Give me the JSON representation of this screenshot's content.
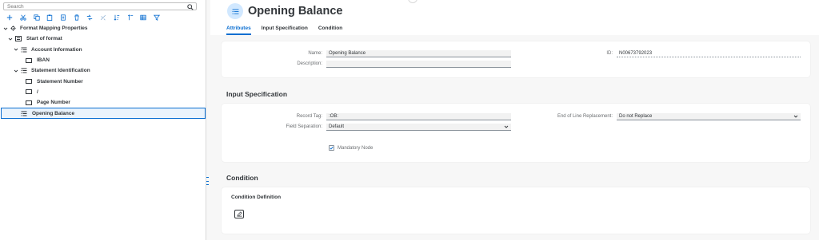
{
  "left": {
    "search": {
      "placeholder": "Search",
      "value": ""
    },
    "toolbar": [
      "add-icon",
      "cut-icon",
      "copy-icon",
      "paste-icon",
      "delete-icon",
      "move-icon",
      "link-icon",
      "sort-icon",
      "sort-up-icon",
      "table-icon",
      "filter-icon"
    ],
    "tree": [
      {
        "label": "Format Mapping Properties",
        "level": 0,
        "expanded": true,
        "icon": "gear-icon"
      },
      {
        "label": "Start of format",
        "level": 1,
        "expanded": true,
        "icon": "format-icon"
      },
      {
        "label": "Account Information",
        "level": 2,
        "expanded": true,
        "icon": "list-icon"
      },
      {
        "label": "IBAN",
        "level": 3,
        "icon": "field-icon"
      },
      {
        "label": "Statement Identification",
        "level": 2,
        "expanded": true,
        "icon": "list-icon"
      },
      {
        "label": "Statement Number",
        "level": 3,
        "icon": "field-icon"
      },
      {
        "label": "/",
        "level": 3,
        "icon": "field-icon"
      },
      {
        "label": "Page Number",
        "level": 3,
        "icon": "field-icon"
      },
      {
        "label": "Opening Balance",
        "level": 2,
        "icon": "list-icon",
        "selected": true
      }
    ]
  },
  "header": {
    "title": "Opening Balance",
    "tabs": [
      {
        "label": "Attributes",
        "active": true
      },
      {
        "label": "Input Specification",
        "active": false
      },
      {
        "label": "Condition",
        "active": false
      }
    ]
  },
  "attributes": {
    "name_label": "Name:",
    "name_value": "Opening Balance",
    "description_label": "Description:",
    "description_value": "",
    "id_label": "ID:",
    "id_value": "N00673792023"
  },
  "input_spec": {
    "title": "Input Specification",
    "record_tag_label": "Record Tag:",
    "record_tag_value": ":OB:",
    "field_sep_label": "Field Separation:",
    "field_sep_value": "Default",
    "eol_label": "End of Line Replacement:",
    "eol_value": "Do not Replace",
    "mandatory_label": "Mandatory Node",
    "mandatory_checked": true
  },
  "condition": {
    "title": "Condition",
    "definition_label": "Condition Definition"
  },
  "colors": {
    "accent": "#0a6ed1",
    "avatar_bg": "#d1e8ff",
    "page_bg": "#f7f7f7"
  }
}
